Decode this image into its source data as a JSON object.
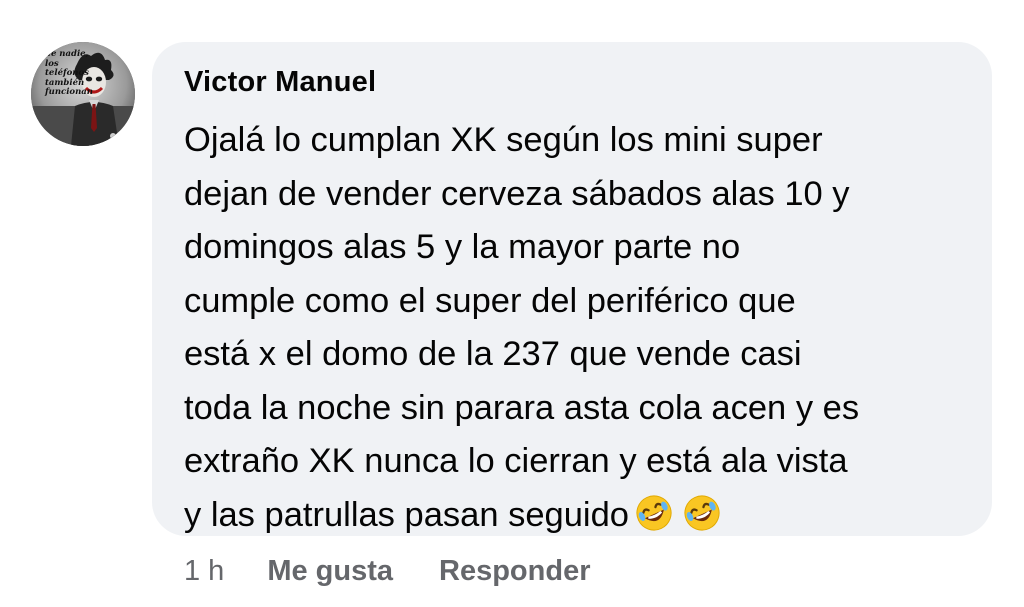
{
  "comment": {
    "author": "Victor Manuel",
    "avatar_caption": "de nadie,\nlos teléfonos\ntambién\nfuncionan",
    "text_lines": [
      "Ojalá lo cumplan XK según los mini super",
      "dejan de vender cerveza sábados alas 10 y",
      "domingos alas 5 y la mayor parte no",
      "cumple como el super del periférico que",
      "está x el domo de la 237 que vende casi",
      "toda la noche sin parara asta cola acen y es",
      "extraño XK nunca lo cierran y está ala vista",
      "y las patrullas pasan seguido"
    ],
    "emojis": [
      "rolling-on-floor-laughing-emoji",
      "rolling-on-floor-laughing-emoji"
    ]
  },
  "actions": {
    "time": "1 h",
    "like_label": "Me gusta",
    "reply_label": "Responder"
  },
  "colors": {
    "bubble_bg": "#f0f2f5",
    "text": "#050505",
    "secondary_text": "#65676b",
    "emoji_face": "#f9c623"
  }
}
